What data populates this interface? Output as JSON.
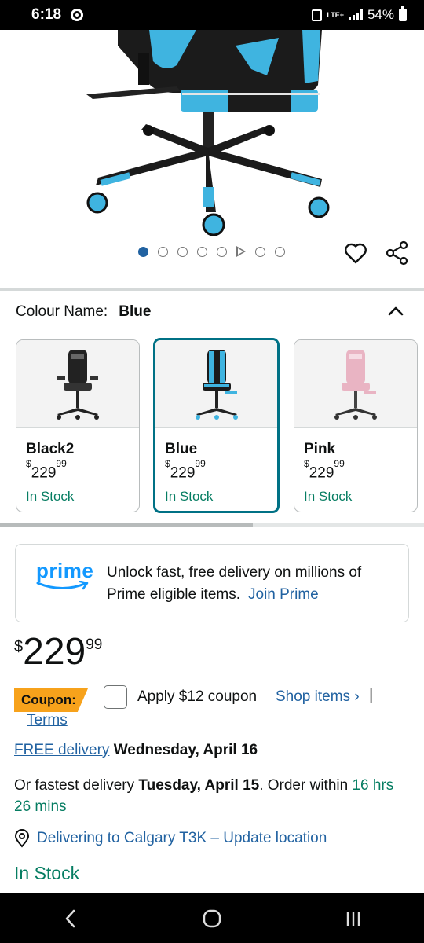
{
  "status_bar": {
    "time": "6:18",
    "network": "LTE+",
    "battery": "54%",
    "icons": [
      "chrome-icon",
      "lock-icon",
      "signal-icon",
      "battery-icon"
    ]
  },
  "carousel": {
    "image_count": 8,
    "active_index": 0,
    "video_index": 5
  },
  "colour": {
    "label": "Colour Name:",
    "selected": "Blue",
    "options": [
      {
        "name": "Black2",
        "currency": "$",
        "whole": "229",
        "fraction": "99",
        "stock": "In Stock",
        "color": "#222222"
      },
      {
        "name": "Blue",
        "currency": "$",
        "whole": "229",
        "fraction": "99",
        "stock": "In Stock",
        "color": "#3fb4e0"
      },
      {
        "name": "Pink",
        "currency": "$",
        "whole": "229",
        "fraction": "99",
        "stock": "In Stock",
        "color": "#e9b4c3"
      }
    ]
  },
  "prime": {
    "logo": "prime",
    "text": "Unlock fast, free delivery on millions of Prime eligible items.",
    "link": "Join Prime"
  },
  "price": {
    "currency": "$",
    "whole": "229",
    "fraction": "99"
  },
  "coupon": {
    "tag": "Coupon:",
    "text": "Apply $12 coupon",
    "shop_link": "Shop items ›",
    "separator": "|",
    "terms": "Terms"
  },
  "delivery": {
    "free_link": "FREE delivery",
    "date": "Wednesday, April 16",
    "fastest_prefix": "Or fastest delivery",
    "fastest_date": "Tuesday, April 15",
    "order_within": ". Order within",
    "countdown": "16 hrs 26 mins"
  },
  "location": {
    "text": "Delivering to Calgary T3K – Update location"
  },
  "availability": "In Stock",
  "colors": {
    "link": "#2162a1",
    "in_stock": "#067d62",
    "selected_border": "#007185",
    "coupon": "#f7a21b",
    "prime": "#1399ff"
  }
}
